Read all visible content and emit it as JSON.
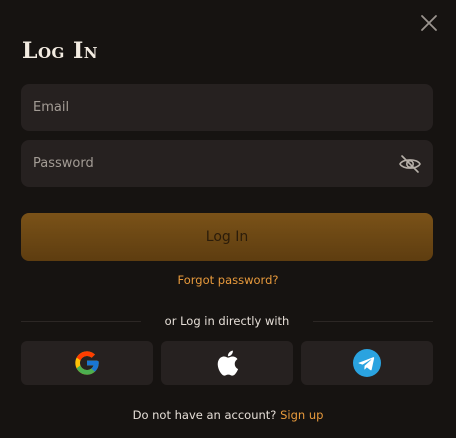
{
  "modal": {
    "title": "Log In",
    "email_placeholder": "Email",
    "password_placeholder": "Password",
    "login_label": "Log In",
    "forgot_label": "Forgot password?",
    "divider_label": "or Log in directly with",
    "signup_prompt": "Do not have an account?",
    "signup_label": "Sign up"
  },
  "icons": {
    "close": "close-icon",
    "password_toggle": "eye-slash-icon",
    "google": "google-icon",
    "apple": "apple-icon",
    "telegram": "telegram-icon"
  },
  "colors": {
    "background": "#161311",
    "field": "#262120",
    "accent": "#e89a3c",
    "button_top": "#7a5218",
    "button_bottom": "#5e3d10",
    "telegram": "#2aa3e0"
  }
}
